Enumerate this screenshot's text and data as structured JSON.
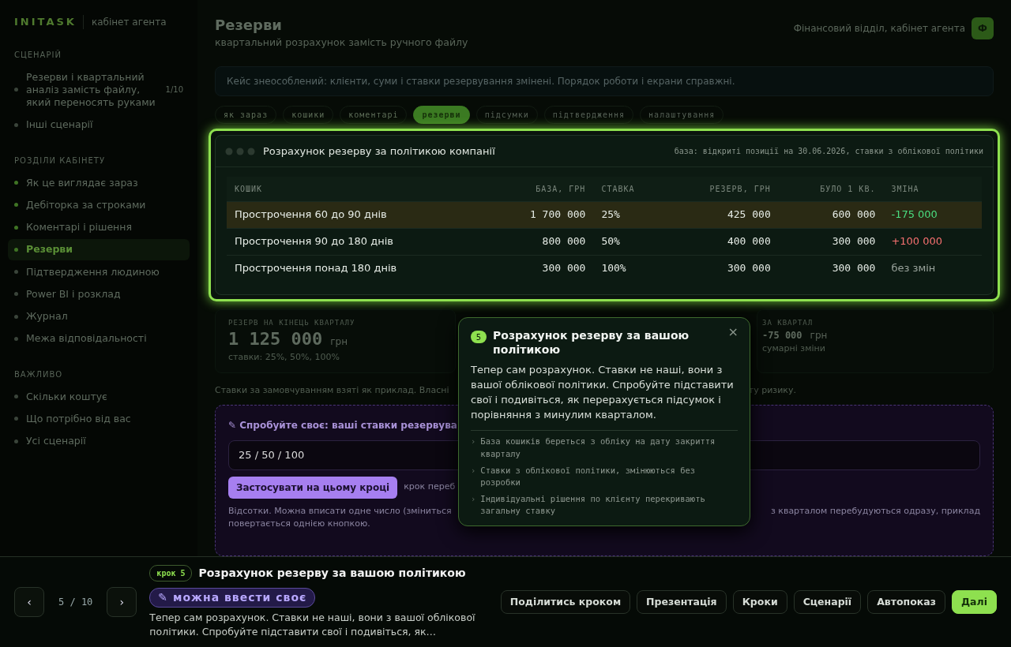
{
  "sidebar": {
    "brand": "INITASK",
    "subtitle": "кабінет агента",
    "sections": [
      {
        "title": "СЦЕНАРІЙ",
        "items": [
          {
            "label": "Резерви і квартальний аналіз замість файлу, який переносять руками",
            "count": "1/10",
            "selected": false,
            "done": false
          },
          {
            "label": "Інші сценарії",
            "selected": false,
            "done": false
          }
        ]
      },
      {
        "title": "РОЗДІЛИ КАБІНЕТУ",
        "items": [
          {
            "label": "Як це виглядає зараз",
            "selected": false,
            "done": true
          },
          {
            "label": "Дебіторка за строками",
            "selected": false,
            "done": true
          },
          {
            "label": "Коментарі і рішення",
            "selected": false,
            "done": true
          },
          {
            "label": "Резерви",
            "selected": true,
            "done": true
          },
          {
            "label": "Підтвердження людиною",
            "selected": false,
            "done": false
          },
          {
            "label": "Power BI і розклад",
            "selected": false,
            "done": false
          },
          {
            "label": "Журнал",
            "selected": false,
            "done": false
          },
          {
            "label": "Межа відповідальності",
            "selected": false,
            "done": false
          }
        ]
      },
      {
        "title": "ВАЖЛИВО",
        "items": [
          {
            "label": "Скільки коштує",
            "selected": false,
            "done": false
          },
          {
            "label": "Що потрібно від вас",
            "selected": false,
            "done": false
          },
          {
            "label": "Усі сценарії",
            "selected": false,
            "done": false
          }
        ]
      }
    ]
  },
  "header": {
    "title": "Резерви",
    "subtitle": "квартальний розрахунок замість ручного файлу",
    "account": "Фінансовий відділ, кабінет агента",
    "avatar": "Ф"
  },
  "banner": "Кейс знеособлений: клієнти, суми і ставки резервування змінені. Порядок роботи і екрани справжні.",
  "tabs": [
    {
      "label": "як зараз",
      "selected": false,
      "done": true
    },
    {
      "label": "кошики",
      "selected": false,
      "done": true
    },
    {
      "label": "коментарі",
      "selected": false,
      "done": true
    },
    {
      "label": "резерви",
      "selected": true,
      "done": true
    },
    {
      "label": "підсумки",
      "selected": false,
      "done": false
    },
    {
      "label": "підтвердження",
      "selected": false,
      "done": false
    },
    {
      "label": "налаштування",
      "selected": false,
      "done": false
    }
  ],
  "table_card": {
    "title": "Розрахунок резерву за політикою компанії",
    "note": "база: відкриті позиції на 30.06.2026, ставки з облікової політики",
    "columns": [
      "КОШИК",
      "БАЗА, ГРН",
      "СТАВКА",
      "РЕЗЕРВ, ГРН",
      "БУЛО 1 КВ.",
      "ЗМІНА"
    ],
    "rows": [
      {
        "cells": [
          "Прострочення 60 до 90 днів",
          "1 700 000",
          "25%",
          "425 000",
          "600 000",
          "-175 000"
        ],
        "color": "#4ade80",
        "selected": true
      },
      {
        "cells": [
          "Прострочення 90 до 180 днів",
          "800 000",
          "50%",
          "400 000",
          "300 000",
          "+100 000"
        ],
        "color": "#f87171",
        "selected": false
      },
      {
        "cells": [
          "Прострочення понад 180 днів",
          "300 000",
          "100%",
          "300 000",
          "300 000",
          "без змін"
        ],
        "color": "#9aa39c",
        "selected": false
      }
    ]
  },
  "summary": [
    {
      "label": "РЕЗЕРВ НА КІНЕЦЬ КВАРТАЛУ",
      "value": "1 125 000",
      "unit": "грн",
      "note": "ставки: 25%, 50%, 100%"
    },
    {
      "label": "ЗА КВАРТАЛ",
      "value": "-75 000",
      "unit": "грн",
      "note": "сумарні зміни"
    }
  ],
  "footnote": [
    "Ставки за замовчуванням взяті як приклад. Власні",
    "ту ризику."
  ],
  "try_card": {
    "title": "✎ Спробуйте своє: ваші ставки резервува",
    "value": "25 / 50 / 100",
    "apply": "Застосувати на цьому кроці",
    "after": "крок переб",
    "hint": [
      "Відсотки. Можна вписати одне число (зміниться",
      "з кварталом перебудуються одразу, приклад",
      "повертається однією кнопкою."
    ]
  },
  "tooltip": {
    "number": "5",
    "title": "Розрахунок резерву за вашою політикою",
    "close": "×",
    "body": "Тепер сам розрахунок. Ставки не наші, вони з вашої облікової політики. Спробуйте підставити свої і подивіться, як перерахується підсумок і порівняння з минулим кварталом.",
    "marker": "›",
    "bullets": [
      "База кошиків береться з обліку на дату закриття кварталу",
      "Ставки з облікової політики, змінюються без розробки",
      "Індивідуальні рішення по клієнту перекривають загальну ставку"
    ]
  },
  "bottom_bar": {
    "prev": "‹",
    "counter": "5 / 10",
    "next": "›",
    "step": "крок 5",
    "title": "Розрахунок резерву за вашою політикою",
    "tag": "✎ можна ввести своє",
    "description": "Тепер сам розрахунок. Ставки не наші, вони з вашої облікової політики. Спробуйте підставити свої і подивіться, як…",
    "buttons": [
      {
        "label": "Поділитись кроком",
        "primary": false
      },
      {
        "label": "Презентація",
        "primary": false
      },
      {
        "label": "Кроки",
        "primary": false
      },
      {
        "label": "Сценарії",
        "primary": false
      },
      {
        "label": "Автопоказ",
        "primary": false
      },
      {
        "label": "Далі",
        "primary": true
      }
    ]
  }
}
